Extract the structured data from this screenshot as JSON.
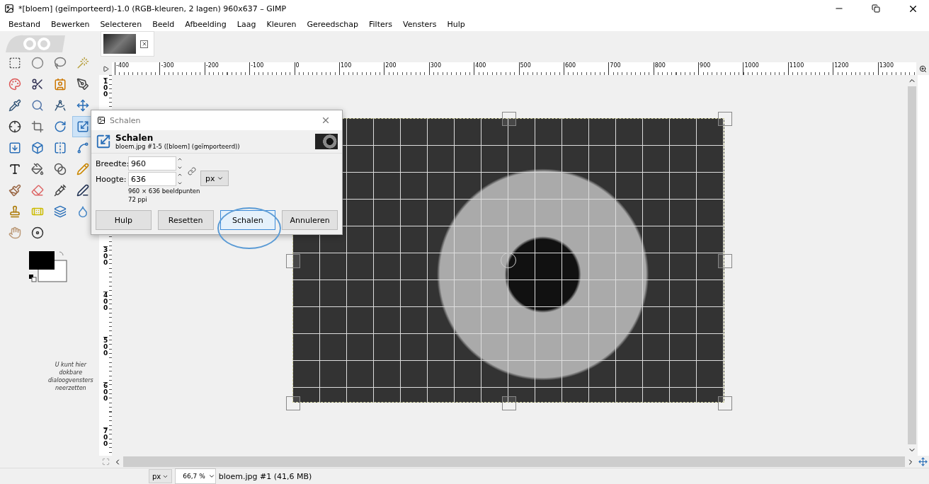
{
  "window": {
    "title": "*[bloem] (geïmporteerd)-1.0 (RGB-kleuren, 2 lagen) 960x637 – GIMP"
  },
  "menu": [
    "Bestand",
    "Bewerken",
    "Selecteren",
    "Beeld",
    "Afbeelding",
    "Laag",
    "Kleuren",
    "Gereedschap",
    "Filters",
    "Vensters",
    "Hulp"
  ],
  "toolbox": {
    "tools": [
      {
        "selected": false
      },
      {
        "selected": false
      },
      {
        "selected": false
      },
      {
        "selected": false
      },
      {
        "selected": false
      },
      {
        "selected": false
      },
      {
        "selected": false
      },
      {
        "selected": false
      },
      {
        "selected": false
      },
      {
        "selected": false
      },
      {
        "selected": false
      },
      {
        "selected": false
      },
      {
        "selected": false
      },
      {
        "selected": false
      },
      {
        "selected": false
      },
      {
        "selected": true
      },
      {
        "selected": false
      },
      {
        "selected": false
      },
      {
        "selected": false
      },
      {
        "selected": false
      },
      {
        "selected": false
      },
      {
        "selected": false
      },
      {
        "selected": false
      },
      {
        "selected": false
      },
      {
        "selected": false
      },
      {
        "selected": false
      },
      {
        "selected": false
      },
      {
        "selected": false
      },
      {
        "selected": false
      },
      {
        "selected": false
      },
      {
        "selected": false
      },
      {
        "selected": false
      },
      {
        "selected": false
      },
      {
        "selected": false
      }
    ],
    "dock_hint": "U kunt hier dokbare dialoogvensters neerzetten"
  },
  "image_tabs": [
    {
      "selected": true
    }
  ],
  "ruler": {
    "horizontal": [
      "-400",
      "-300",
      "-200",
      "-100",
      "0",
      "100",
      "200",
      "300",
      "400",
      "500",
      "600",
      "700",
      "800",
      "900",
      "1000",
      "1100",
      "1200",
      "1300"
    ],
    "vertical": [
      "100",
      "300",
      "400",
      "500",
      "600",
      "700"
    ]
  },
  "dialog": {
    "title": "Schalen",
    "heading": "Schalen",
    "subtitle": "bloem.jpg #1-5 ([bloem] (geïmporteerd))",
    "fields": [
      {
        "label": "Breedte:",
        "value": "960"
      },
      {
        "label": "Hoogte:",
        "value": "636"
      }
    ],
    "unit": "px",
    "info": [
      "960 × 636 beeldpunten",
      "72 ppi"
    ],
    "buttons": [
      {
        "label": "Hulp",
        "focused": false
      },
      {
        "label": "Resetten",
        "focused": false
      },
      {
        "label": "Schalen",
        "focused": true
      },
      {
        "label": "Annuleren",
        "focused": false
      }
    ]
  },
  "status_bar": {
    "unit": "px",
    "zoom": "66,7 %",
    "info": "bloem.jpg #1 (41,6 MB)"
  }
}
